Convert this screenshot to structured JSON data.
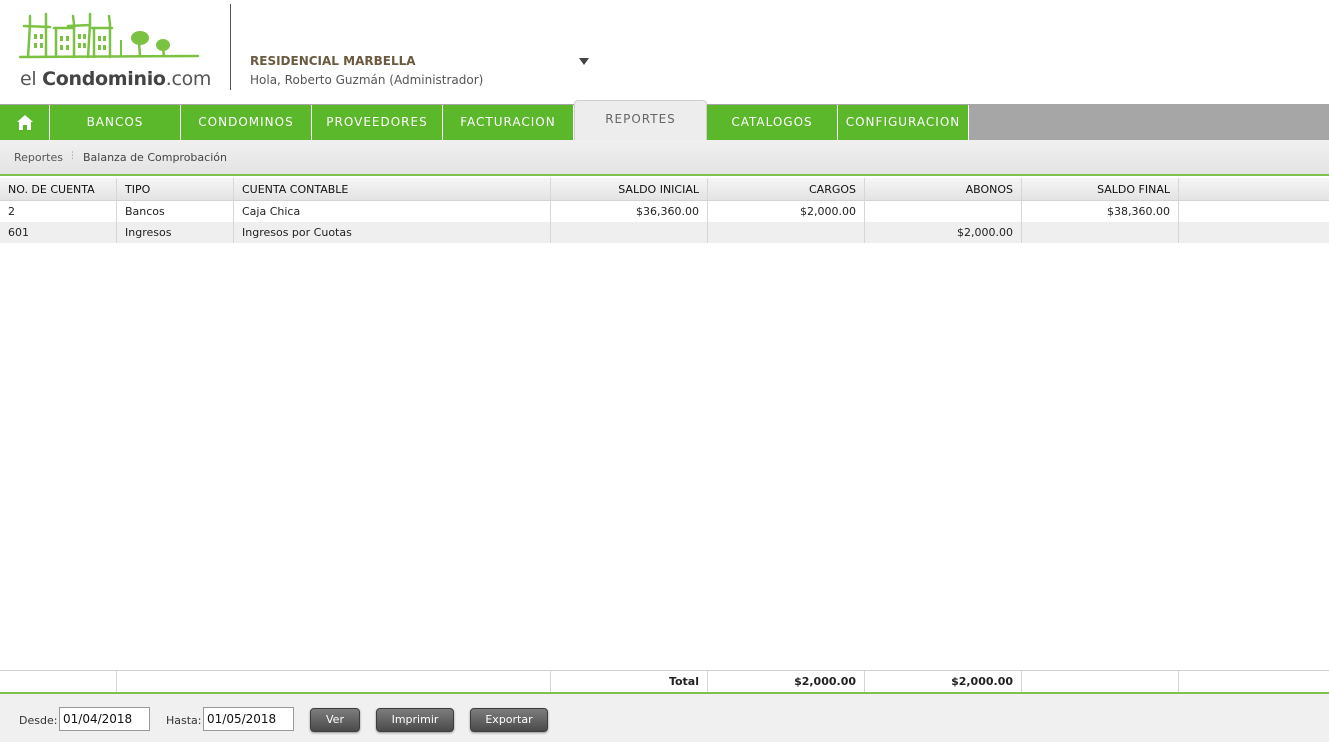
{
  "logo": {
    "prefix": "el ",
    "brand": "Condominio",
    "suffix": ".com"
  },
  "header": {
    "residence": "RESIDENCIAL MARBELLA",
    "greeting": "Hola, Roberto Guzmán (Administrador)"
  },
  "nav": {
    "items": [
      {
        "label": "BANCOS"
      },
      {
        "label": "CONDOMINOS"
      },
      {
        "label": "PROVEEDORES"
      },
      {
        "label": "FACTURACION"
      },
      {
        "label": "REPORTES"
      },
      {
        "label": "CATALOGOS"
      },
      {
        "label": "CONFIGURACION"
      }
    ],
    "active": "REPORTES"
  },
  "breadcrumb": {
    "parent": "Reportes",
    "sep": "⋮",
    "current": "Balanza de Comprobación"
  },
  "table": {
    "headers": [
      "NO. DE CUENTA",
      "TIPO",
      "CUENTA CONTABLE",
      "SALDO INICIAL",
      "CARGOS",
      "ABONOS",
      "SALDO FINAL"
    ],
    "rows": [
      [
        "2",
        "Bancos",
        "Caja Chica",
        "$36,360.00",
        "$2,000.00",
        "",
        "$38,360.00"
      ],
      [
        "601",
        "Ingresos",
        "Ingresos por Cuotas",
        "",
        "",
        "$2,000.00",
        ""
      ]
    ],
    "total": {
      "label": "Total",
      "cargos": "$2,000.00",
      "abonos": "$2,000.00"
    }
  },
  "filters": {
    "desde_label": "Desde:",
    "desde_value": "01/04/2018",
    "hasta_label": "Hasta:",
    "hasta_value": "01/05/2018"
  },
  "buttons": {
    "ver": "Ver",
    "imprimir": "Imprimir",
    "exportar": "Exportar"
  },
  "colors": {
    "accent": "#5cb82b",
    "nav_bg": "#a6a6a6",
    "button": "#555555"
  }
}
